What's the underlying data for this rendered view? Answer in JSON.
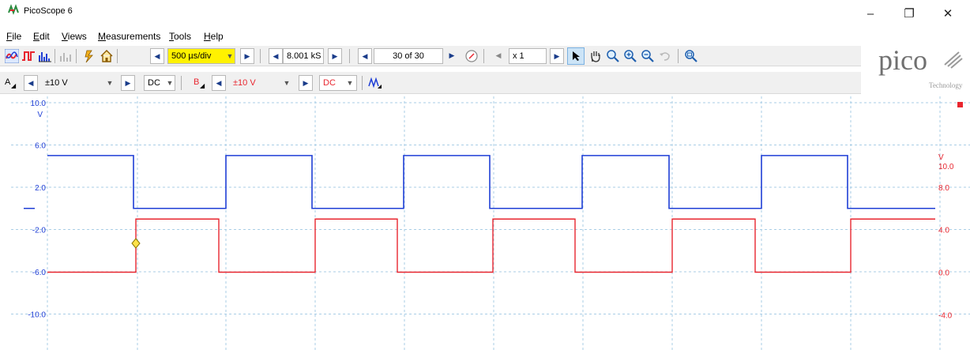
{
  "window": {
    "title": "PicoScope 6",
    "minimize_glyph": "–",
    "restore_glyph": "❐",
    "close_glyph": "✕"
  },
  "menu": {
    "items": [
      "File",
      "Edit",
      "Views",
      "Measurements",
      "Tools",
      "Help"
    ]
  },
  "toolbar": {
    "timebase": "500 µs/div",
    "samples": "8.001 kS",
    "buffer": "30 of 30",
    "zoom": "x 1"
  },
  "channel_bar": {
    "channel_a": {
      "label": "A",
      "range": "±10 V",
      "coupling": "DC",
      "color": "#1f3fd6"
    },
    "channel_b": {
      "label": "B",
      "range": "±10 V",
      "coupling": "DC",
      "color": "#e8262f"
    }
  },
  "logo": {
    "brand": "pico",
    "sub": "Technology"
  },
  "scope": {
    "left_axis": {
      "unit": "V",
      "ticks": [
        "10.0",
        "6.0",
        "2.0",
        "-2.0",
        "-6.0",
        "-10.0"
      ],
      "color": "#1f3fd6"
    },
    "right_axis": {
      "unit": "V",
      "ticks": [
        "10.0",
        "8.0",
        "4.0",
        "0.0",
        "-4.0"
      ],
      "color": "#e8262f"
    },
    "channel_a_trace": {
      "color": "#1f3fd6",
      "high_v": 5.0,
      "low_v": 0.0
    },
    "channel_b_trace": {
      "color": "#e8262f",
      "high_v": 5.0,
      "low_v": 0.0
    },
    "grid_color": "#a9cde6"
  }
}
